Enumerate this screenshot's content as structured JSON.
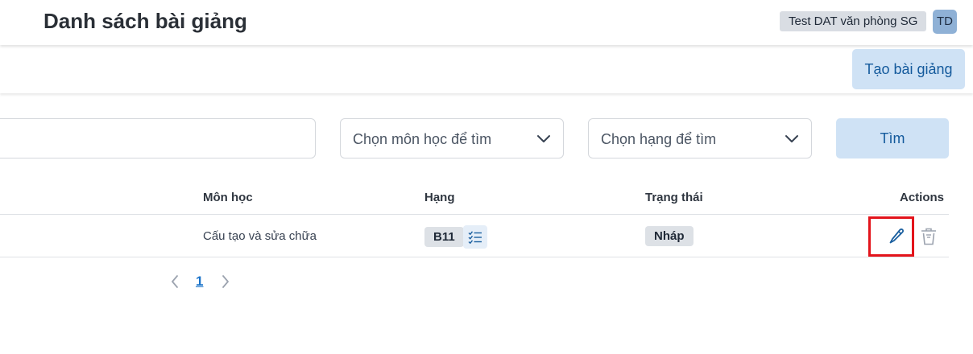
{
  "header": {
    "title": "Danh sách bài giảng",
    "org_name": "Test DAT văn phòng SG",
    "avatar_initials": "TD"
  },
  "toolbar": {
    "create_label": "Tạo bài giảng"
  },
  "filters": {
    "search_value": "",
    "subject_placeholder": "Chọn môn học để tìm",
    "rank_placeholder": "Chọn hạng để tìm",
    "search_label": "Tìm"
  },
  "table": {
    "columns": [
      "Môn học",
      "Hạng",
      "Trạng thái",
      "Actions"
    ],
    "rows": [
      {
        "subject": "Cấu tạo và sửa chữa",
        "rank": "B11",
        "status": "Nháp"
      }
    ]
  },
  "pagination": {
    "current_page": "1"
  },
  "colors": {
    "accent": "#145a9c",
    "button_bg": "#cfe2f5",
    "highlight": "#e3141b"
  },
  "icons": [
    "chevron-down-icon",
    "checklist-icon",
    "pencil-icon",
    "trash-icon",
    "chevron-left-icon",
    "chevron-right-icon"
  ]
}
